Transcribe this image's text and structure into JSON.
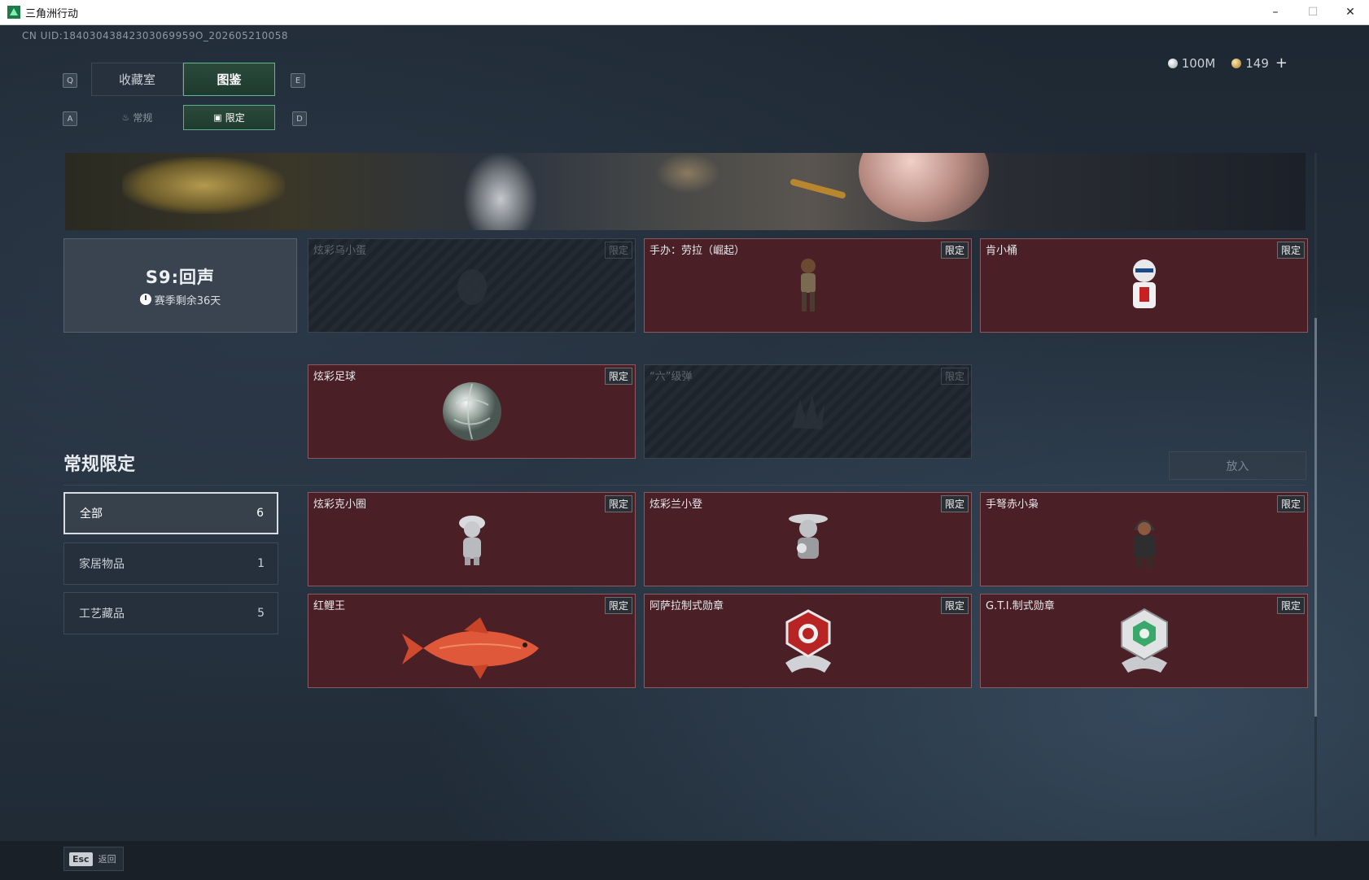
{
  "window": {
    "title": "三角洲行动",
    "min": "–",
    "max": "☐",
    "close": "✕"
  },
  "uid": "CN UID:18403043842303069959O_202605210058",
  "currency": {
    "silver": "100M",
    "gold": "149",
    "plus": "+"
  },
  "keys": {
    "q": "Q",
    "e": "E",
    "a": "A",
    "d": "D",
    "esc": "Esc"
  },
  "tabs": {
    "collection": "收藏室",
    "codex": "图鉴"
  },
  "subtabs": {
    "normal": "常规",
    "limited": "限定"
  },
  "season": {
    "title": "S9:回声",
    "remaining": "赛季剩余36天"
  },
  "tag": "限定",
  "season_items": [
    {
      "name": "炫彩乌小蛋",
      "locked": true
    },
    {
      "name": "手办：劳拉（崛起）",
      "locked": false
    },
    {
      "name": "肯小桶",
      "locked": false
    },
    {
      "name": "炫彩足球",
      "locked": false
    },
    {
      "name": "“六”级弹",
      "locked": true
    }
  ],
  "section": {
    "title": "常规限定",
    "put_button": "放入"
  },
  "categories": [
    {
      "label": "全部",
      "count": "6"
    },
    {
      "label": "家居物品",
      "count": "1"
    },
    {
      "label": "工艺藏品",
      "count": "5"
    }
  ],
  "regular_items": [
    {
      "name": "炫彩克小圈"
    },
    {
      "name": "炫彩兰小登"
    },
    {
      "name": "手弩赤小枭"
    },
    {
      "name": "红鲤王"
    },
    {
      "name": "阿萨拉制式勋章"
    },
    {
      "name": "G.T.I.制式勋章"
    }
  ],
  "footer": {
    "back": "返回"
  },
  "colors": {
    "card_bg": "#4a1f26",
    "accent_green": "#5fb98a",
    "locked_bg": "#232a32"
  }
}
